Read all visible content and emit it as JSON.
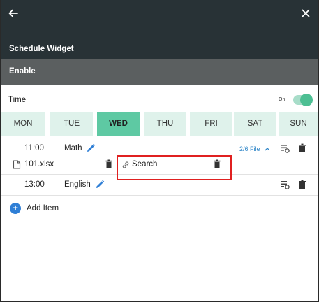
{
  "header": {
    "back_icon": "arrow-left-icon",
    "close_icon": "close-icon",
    "title": "Schedule Widget"
  },
  "enable": {
    "label": "Enable"
  },
  "time": {
    "label": "Time",
    "toggle_state_label": "On",
    "toggle_on": true
  },
  "days": [
    {
      "label": "MON",
      "active": false
    },
    {
      "label": "TUE",
      "active": false
    },
    {
      "label": "WED",
      "active": true
    },
    {
      "label": "THU",
      "active": false
    },
    {
      "label": "FRI",
      "active": false
    },
    {
      "label": "SAT",
      "active": false
    },
    {
      "label": "SUN",
      "active": false
    }
  ],
  "schedule": [
    {
      "time": "11:00",
      "subject": "Math",
      "file_count": "2/6 File",
      "file": {
        "name": "101.xlsx"
      },
      "link": {
        "label": "Search"
      }
    },
    {
      "time": "13:00",
      "subject": "English"
    }
  ],
  "add_item": {
    "label": "Add Item"
  },
  "colors": {
    "header_bg": "#283236",
    "enable_bg": "#5b5f60",
    "day_bg": "#dff2eb",
    "day_active_bg": "#5ec9a3",
    "toggle_knob": "#4dbf93",
    "link_blue": "#2f86c8",
    "add_blue": "#2f7fd6",
    "highlight_red": "#e02020"
  }
}
